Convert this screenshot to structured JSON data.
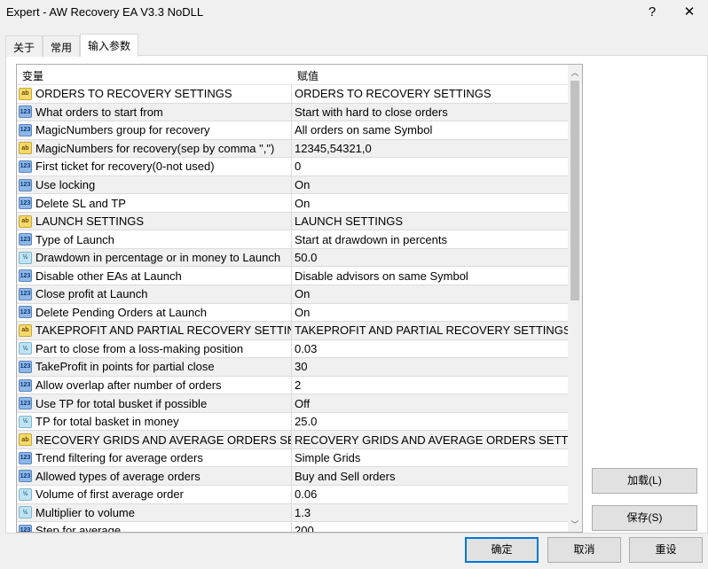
{
  "window": {
    "title": "Expert - AW Recovery EA V3.3 NoDLL",
    "help": "?",
    "close": "✕"
  },
  "tabs": [
    {
      "label": "关于"
    },
    {
      "label": "常用"
    },
    {
      "label": "输入参数"
    }
  ],
  "grid": {
    "col_variable": "变量",
    "col_value": "赋值",
    "rows": [
      {
        "type": "ab",
        "name": "ORDERS TO RECOVERY SETTINGS",
        "value": "ORDERS TO RECOVERY SETTINGS"
      },
      {
        "type": "int",
        "name": "What orders to start from",
        "value": "Start with hard to close orders"
      },
      {
        "type": "int",
        "name": "MagicNumbers group for recovery",
        "value": "All orders on same Symbol"
      },
      {
        "type": "ab",
        "name": "MagicNumbers for recovery(sep by comma \",\")",
        "value": "12345,54321,0"
      },
      {
        "type": "int",
        "name": "First ticket for recovery(0-not used)",
        "value": "0"
      },
      {
        "type": "int",
        "name": "Use locking",
        "value": "On"
      },
      {
        "type": "int",
        "name": "Delete SL and TP",
        "value": "On"
      },
      {
        "type": "ab",
        "name": "LAUNCH SETTINGS",
        "value": "LAUNCH SETTINGS"
      },
      {
        "type": "int",
        "name": "Type of Launch",
        "value": "Start at drawdown in percents"
      },
      {
        "type": "dbl",
        "name": "Drawdown in percentage or in money to Launch",
        "value": "50.0"
      },
      {
        "type": "int",
        "name": "Disable other EAs at Launch",
        "value": "Disable advisors on same Symbol"
      },
      {
        "type": "int",
        "name": "Close profit at Launch",
        "value": "On"
      },
      {
        "type": "int",
        "name": "Delete Pending Orders at Launch",
        "value": "On"
      },
      {
        "type": "ab",
        "name": "TAKEPROFIT AND PARTIAL RECOVERY SETTINGS",
        "value": "TAKEPROFIT AND PARTIAL RECOVERY SETTINGS"
      },
      {
        "type": "dbl",
        "name": "Part to close from a loss-making position",
        "value": "0.03"
      },
      {
        "type": "int",
        "name": "TakeProfit in points for partial close",
        "value": "30"
      },
      {
        "type": "int",
        "name": "Allow overlap after number of orders",
        "value": "2"
      },
      {
        "type": "int",
        "name": "Use TP for total busket if possible",
        "value": "Off"
      },
      {
        "type": "dbl",
        "name": "TP for total basket in money",
        "value": "25.0"
      },
      {
        "type": "ab",
        "name": "RECOVERY GRIDS AND AVERAGE ORDERS SETTI...",
        "value": "RECOVERY GRIDS AND AVERAGE ORDERS SETTINGS"
      },
      {
        "type": "int",
        "name": "Trend filtering for average orders",
        "value": "Simple Grids"
      },
      {
        "type": "int",
        "name": "Allowed types of average orders",
        "value": "Buy and Sell orders"
      },
      {
        "type": "dbl",
        "name": "Volume of first average order",
        "value": "0.06"
      },
      {
        "type": "dbl",
        "name": "Multiplier to volume",
        "value": "1.3"
      },
      {
        "type": "int",
        "name": "Step for average",
        "value": "200"
      }
    ]
  },
  "icons": {
    "ab": "ab",
    "int": "123",
    "dbl": "½"
  },
  "buttons": {
    "load": "加载(L)",
    "save": "保存(S)",
    "ok": "确定",
    "cancel": "取消",
    "reset": "重设"
  },
  "accent": "#0078d7"
}
